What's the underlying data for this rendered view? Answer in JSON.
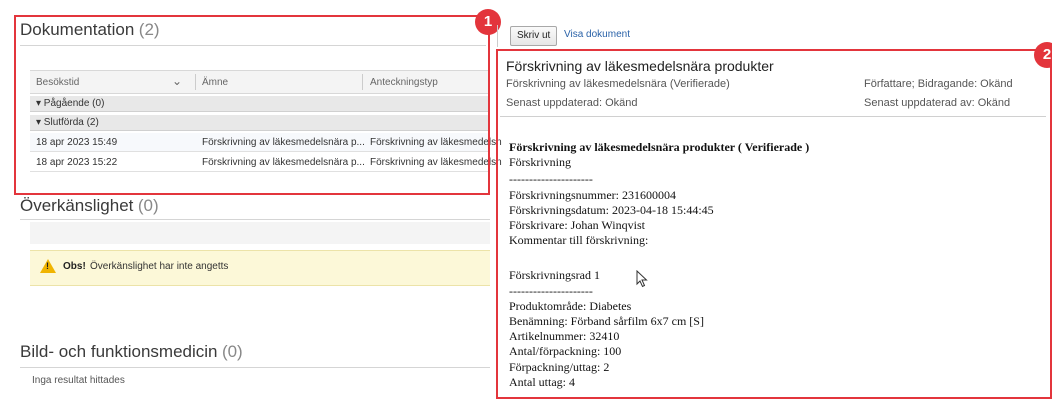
{
  "left": {
    "doc_section": {
      "title": "Dokumentation",
      "count": "(2)"
    },
    "columns": [
      "Besökstid",
      "Ämne",
      "Anteckningstyp"
    ],
    "groups": {
      "ongoing": "▾ Pågående (0)",
      "finished": "▾ Slutförda (2)"
    },
    "rows": [
      {
        "time": "18 apr 2023 15:49",
        "subject": "Förskrivning av läkesmedelsnära p...",
        "type": "Förskrivning av läkesmedelsn"
      },
      {
        "time": "18 apr 2023 15:22",
        "subject": "Förskrivning av läkesmedelsnära p...",
        "type": "Förskrivning av läkesmedelsn"
      }
    ],
    "allergy_section": {
      "title": "Överkänslighet",
      "count": "(0)"
    },
    "warning": {
      "bold": "Obs!",
      "text": "Överkänslighet har inte angetts"
    },
    "imaging_section": {
      "title": "Bild- och funktionsmedicin",
      "count": "(0)"
    },
    "no_results": "Inga resultat hittades"
  },
  "right": {
    "toolbar": {
      "print_label": "Skriv ut",
      "view_link": "Visa dokument"
    },
    "document": {
      "title": "Förskrivning av läkesmedelsnära produkter",
      "subtitle": "Förskrivning av läkesmedelsnära (Verifierade)",
      "author": "Författare; Bidragande: Okänd",
      "updated": "Senast uppdaterad: Okänd",
      "updated_by": "Senast uppdaterad av: Okänd",
      "body_heading": "Förskrivning av läkesmedelsnära produkter ( Verifierade )",
      "lines": [
        "Förskrivning",
        "---------------------",
        "Förskrivningsnummer: 231600004",
        "Förskrivningsdatum: 2023-04-18 15:44:45",
        "Förskrivare: Johan Winqvist",
        "Kommentar till förskrivning:",
        "",
        "Förskrivningsrad 1",
        "---------------------",
        "Produktområde: Diabetes",
        "Benämning: Förband sårfilm 6x7 cm [S]",
        "Artikelnummer: 32410",
        "Antal/förpackning: 100",
        "Förpackning/uttag: 2",
        "Antal uttag: 4"
      ]
    }
  },
  "badges": {
    "one": "1",
    "two": "2"
  },
  "colors": {
    "highlight": "#e3353c",
    "warning_bg": "#fcf8d8",
    "link": "#2a62a8"
  }
}
